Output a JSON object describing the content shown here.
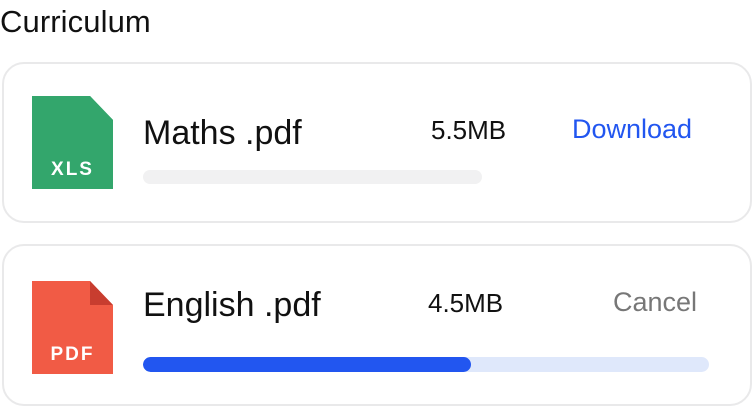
{
  "section": {
    "title": "Curriculum"
  },
  "files": [
    {
      "icon": {
        "type": "XLS",
        "name": "xls-file-icon",
        "color": "#33a66c",
        "fold_color": "#33a66c"
      },
      "name": "Maths .pdf",
      "size": "5.5MB",
      "action": "Download",
      "progress": 0,
      "action_color": "#2256f0"
    },
    {
      "icon": {
        "type": "PDF",
        "name": "pdf-file-icon",
        "color": "#f15b45",
        "fold_color": "#c83d2f"
      },
      "name": "English .pdf",
      "size": "4.5MB",
      "action": "Cancel",
      "progress": 0.58,
      "action_color": "#777777"
    }
  ],
  "colors": {
    "primary": "#2256f0",
    "card_border": "#e9e9ea",
    "empty_track": "#f1f1f2",
    "active_track": "#dfe8fb"
  }
}
